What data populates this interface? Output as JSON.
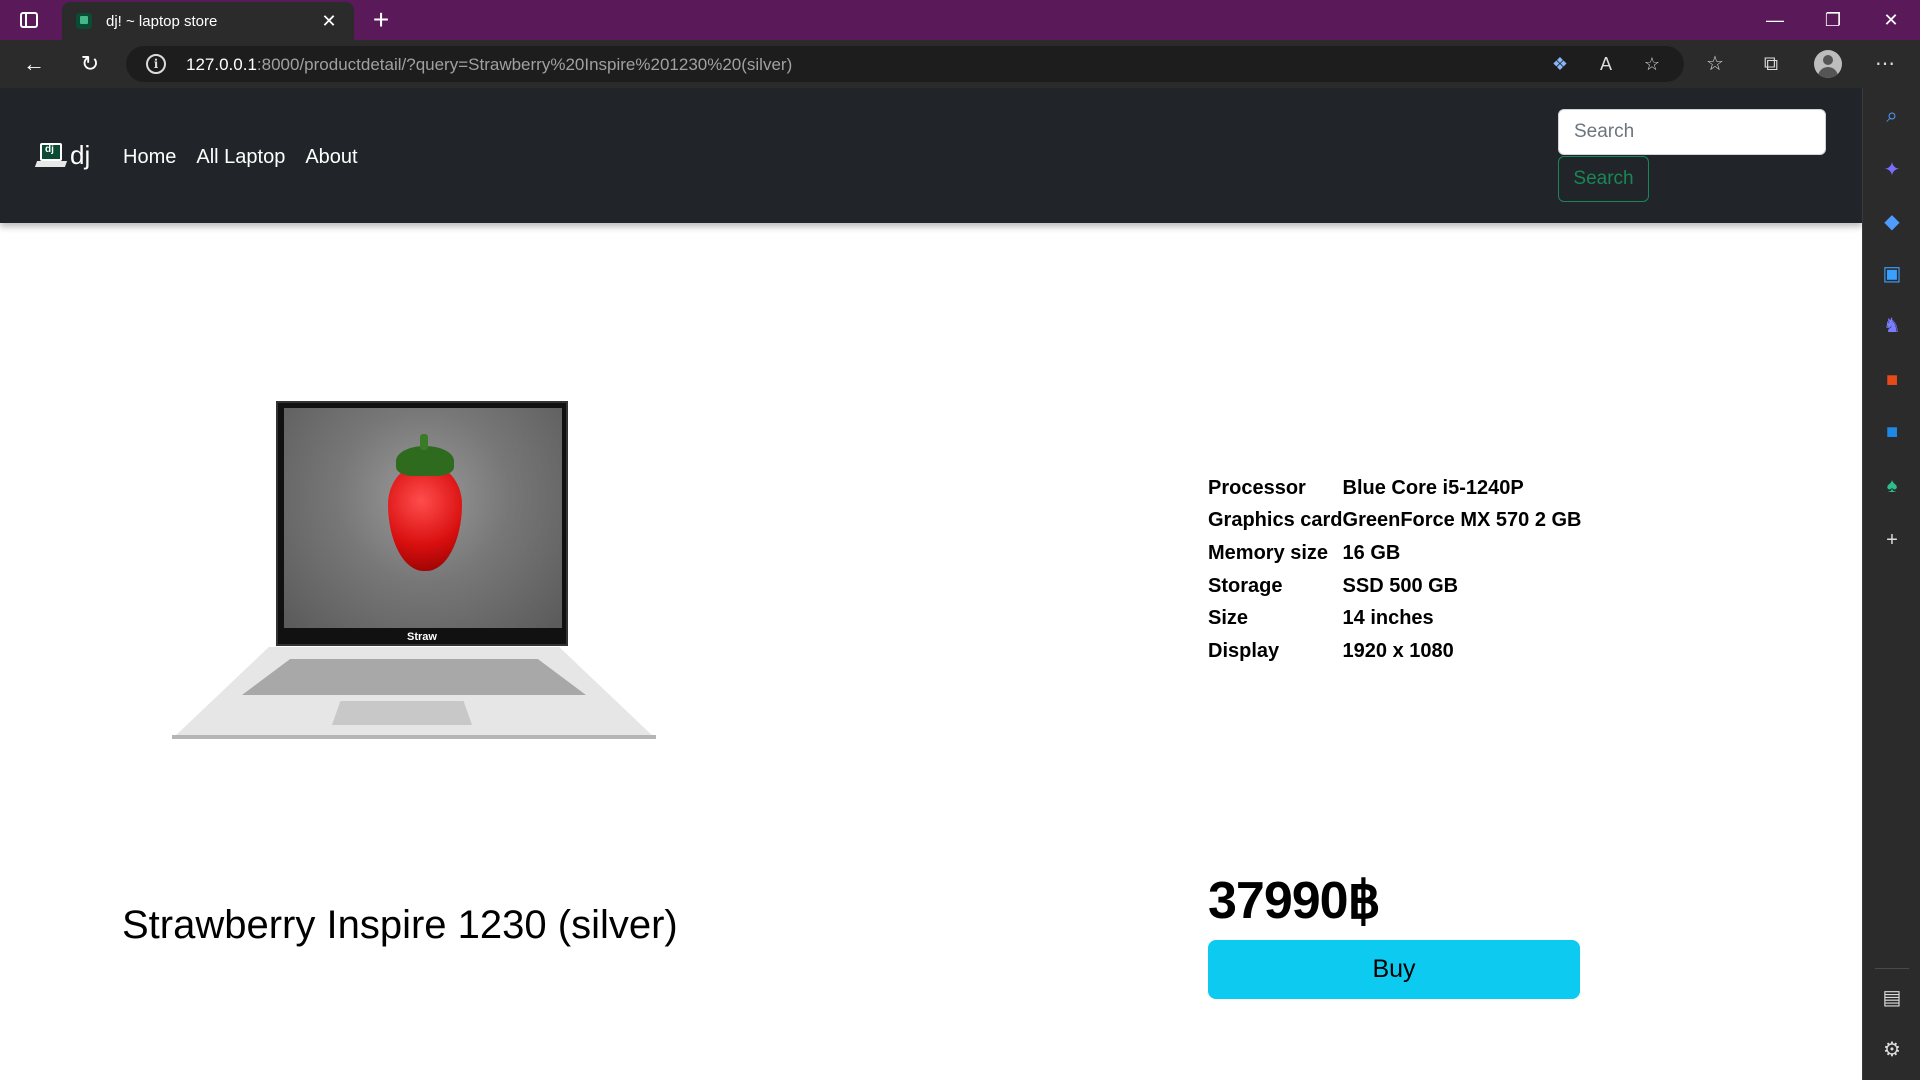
{
  "browser": {
    "tab_title": "dj! ~ laptop store",
    "url_host": "127.0.0.1",
    "url_rest": ":8000/productdetail/?query=Strawberry%20Inspire%201230%20(silver)"
  },
  "navbar": {
    "brand": "dj",
    "links": [
      "Home",
      "All Laptop",
      "About"
    ],
    "search_placeholder": "Search",
    "search_button": "Search"
  },
  "product": {
    "name": "Strawberry Inspire 1230 (silver)",
    "image_label": "Straw",
    "price": "37990฿",
    "buy_label": "Buy",
    "specs": [
      {
        "key": "Processor",
        "value": "Blue Core i5-1240P"
      },
      {
        "key": "Graphics card",
        "value": "GreenForce MX 570 2 GB"
      },
      {
        "key": "Memory size",
        "value": "16 GB"
      },
      {
        "key": "Storage",
        "value": "SSD 500 GB"
      },
      {
        "key": "Size",
        "value": "14 inches"
      },
      {
        "key": "Display",
        "value": "1920 x 1080"
      }
    ]
  },
  "colors": {
    "tabbar": "#5a1a5a",
    "navbar": "#212529",
    "search_button": "#198754",
    "buy_button": "#0dcaf0"
  },
  "icons": {
    "sidebar": [
      "search-icon",
      "copilot-icon",
      "shopping-tag-icon",
      "tools-icon",
      "games-icon",
      "office-icon",
      "outlook-icon",
      "drop-icon",
      "add-icon",
      "split-screen-icon",
      "settings-icon"
    ]
  }
}
